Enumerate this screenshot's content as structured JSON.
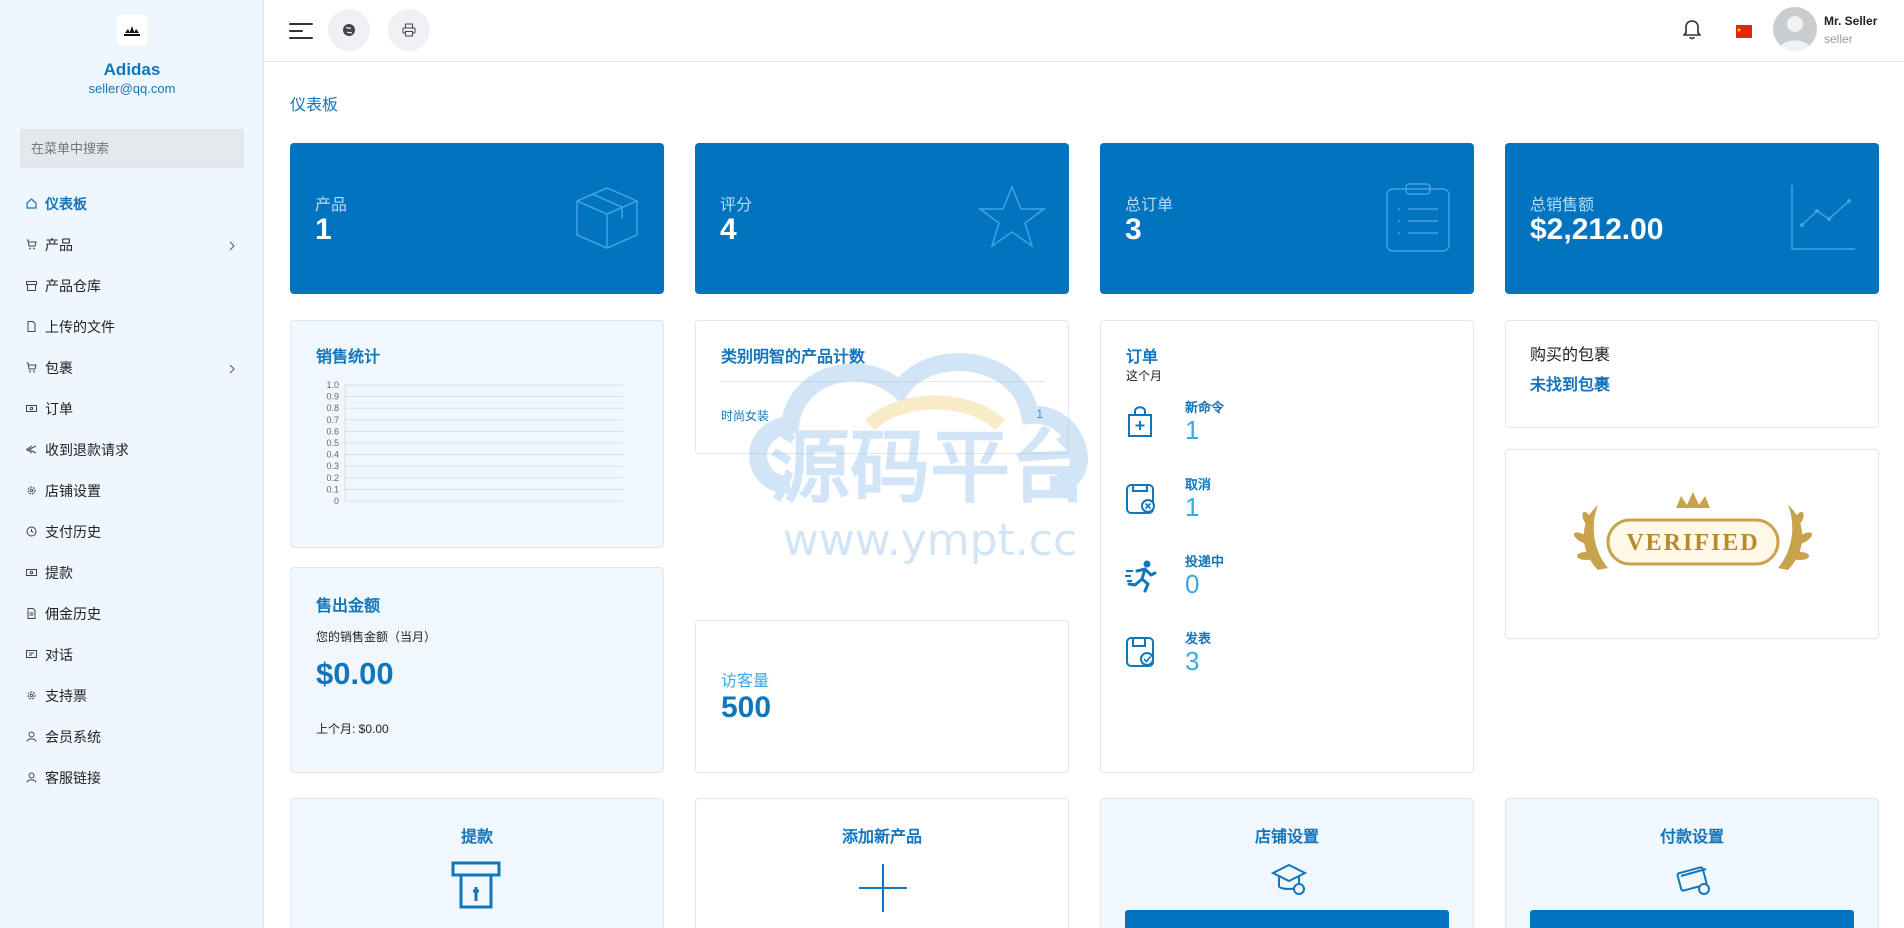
{
  "sidebar": {
    "shop_name": "Adidas",
    "email": "seller@qq.com",
    "search_placeholder": "在菜单中搜索",
    "items": [
      {
        "label": "仪表板",
        "icon": "home-icon"
      },
      {
        "label": "产品",
        "icon": "cart-icon",
        "has_submenu": true
      },
      {
        "label": "产品仓库",
        "icon": "archive-icon"
      },
      {
        "label": "上传的文件",
        "icon": "file-icon"
      },
      {
        "label": "包裹",
        "icon": "cart-icon",
        "has_submenu": true
      },
      {
        "label": "订单",
        "icon": "money-icon"
      },
      {
        "label": "收到退款请求",
        "icon": "refund-icon"
      },
      {
        "label": "店铺设置",
        "icon": "gear-icon"
      },
      {
        "label": "支付历史",
        "icon": "history-icon"
      },
      {
        "label": "提款",
        "icon": "money-icon"
      },
      {
        "label": "佣金历史",
        "icon": "file-icon"
      },
      {
        "label": "对话",
        "icon": "chat-icon"
      },
      {
        "label": "支持票",
        "icon": "gear-icon"
      },
      {
        "label": "会员系统",
        "icon": "user-icon"
      },
      {
        "label": "客服链接",
        "icon": "user-icon"
      }
    ]
  },
  "topbar": {
    "user_name": "Mr. Seller",
    "user_role": "seller"
  },
  "page_title": "仪表板",
  "stats": [
    {
      "label": "产品",
      "value": "1",
      "icon": "box-icon"
    },
    {
      "label": "评分",
      "value": "4",
      "icon": "star-icon"
    },
    {
      "label": "总订单",
      "value": "3",
      "icon": "clipboard-icon"
    },
    {
      "label": "总销售额",
      "value": "$2,212.00",
      "icon": "line-chart-icon"
    }
  ],
  "sales_stats": {
    "title": "销售统计"
  },
  "chart_data": {
    "type": "line",
    "title": "销售统计",
    "xlabel": "",
    "ylabel": "",
    "ylim": [
      0,
      1.0
    ],
    "y_ticks": [
      "0",
      "0.1",
      "0.2",
      "0.3",
      "0.4",
      "0.5",
      "0.6",
      "0.7",
      "0.8",
      "0.9",
      "1.0"
    ],
    "grid": true,
    "series": []
  },
  "category_count": {
    "title": "类别明智的产品计数",
    "rows": [
      {
        "name": "时尚女装",
        "count": "1"
      }
    ]
  },
  "orders": {
    "title": "订单",
    "subtitle": "这个月",
    "items": [
      {
        "label": "新命令",
        "value": "1",
        "icon": "bag-plus-icon"
      },
      {
        "label": "取消",
        "value": "1",
        "icon": "cancel-box-icon"
      },
      {
        "label": "投递中",
        "value": "0",
        "icon": "running-icon"
      },
      {
        "label": "发表",
        "value": "3",
        "icon": "save-check-icon"
      }
    ]
  },
  "package": {
    "title": "购买的包裹",
    "status": "未找到包裹"
  },
  "verified": {
    "text": "VERIFIED"
  },
  "sold_amount": {
    "title": "售出金额",
    "subtitle": "您的销售金额（当月）",
    "value": "$0.00",
    "last_month": "上个月: $0.00"
  },
  "visitors": {
    "label": "访客量",
    "value": "500"
  },
  "bottom_cards": [
    {
      "title": "提款",
      "icon": "withdraw-icon"
    },
    {
      "title": "添加新产品",
      "icon": "plus-icon"
    },
    {
      "title": "店铺设置",
      "icon": "shop-settings-icon"
    },
    {
      "title": "付款设置",
      "icon": "card-settings-icon"
    }
  ],
  "watermark": {
    "main": "源码平台",
    "url": "www.ympt.cc"
  },
  "colors": {
    "primary": "#0273bf",
    "link": "#1276bd",
    "accent": "#39a9e0",
    "sidebar_bg": "#eef7fd"
  }
}
